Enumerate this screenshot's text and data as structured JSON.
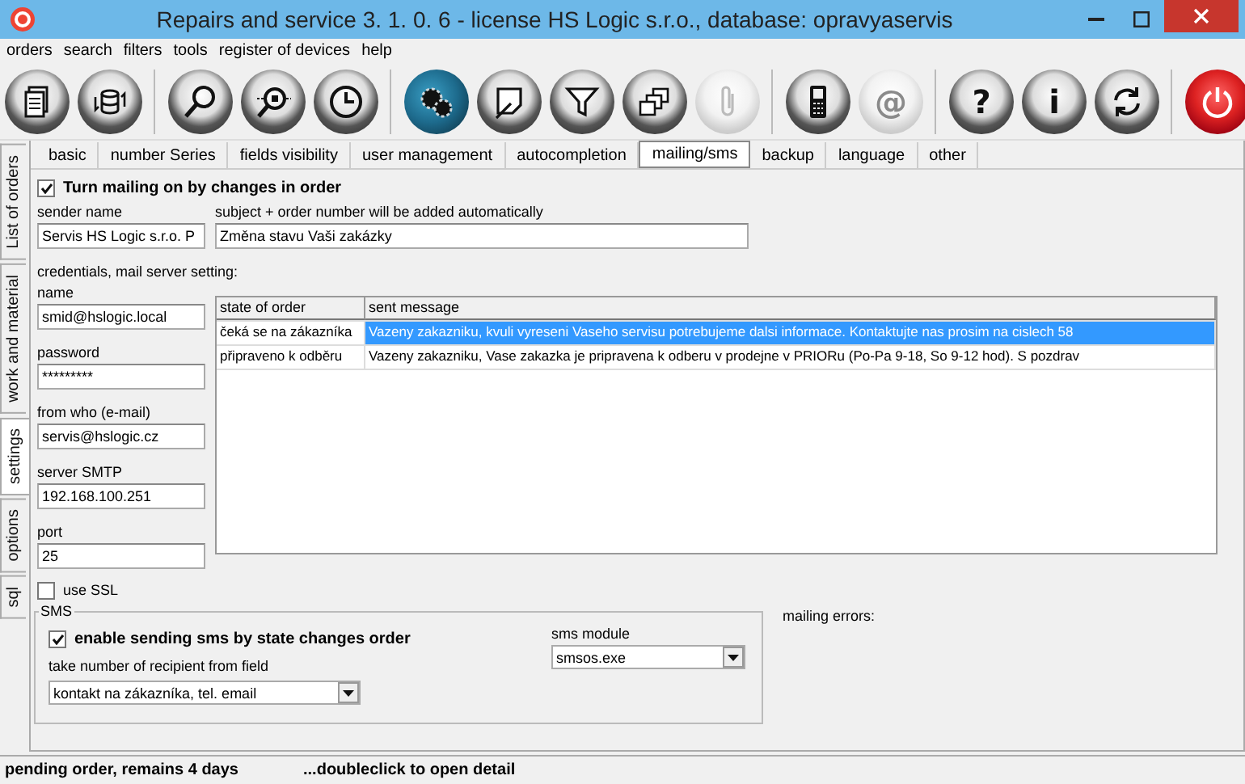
{
  "window": {
    "title": "Repairs and service 3. 1. 0. 6 - license HS Logic s.r.o., database: opravyaservis"
  },
  "menu": [
    "orders",
    "search",
    "filters",
    "tools",
    "register of devices",
    "help"
  ],
  "toolbar_groups": [
    [
      {
        "kind": "documents",
        "disabled": false
      },
      {
        "kind": "database",
        "disabled": false
      }
    ],
    [
      {
        "kind": "search",
        "disabled": false
      },
      {
        "kind": "search-node",
        "disabled": false
      },
      {
        "kind": "clock",
        "disabled": false
      }
    ],
    [
      {
        "kind": "gears",
        "disabled": false
      },
      {
        "kind": "note",
        "disabled": false
      },
      {
        "kind": "filter",
        "disabled": false
      },
      {
        "kind": "windows",
        "disabled": false
      },
      {
        "kind": "paperclip",
        "disabled": true
      }
    ],
    [
      {
        "kind": "phone",
        "disabled": false
      },
      {
        "kind": "glyph",
        "label": "@",
        "disabled": true
      }
    ],
    [
      {
        "kind": "glyph",
        "label": "?",
        "disabled": false
      },
      {
        "kind": "glyph",
        "label": "i",
        "disabled": false
      },
      {
        "kind": "refresh",
        "disabled": false
      }
    ],
    [
      {
        "kind": "power",
        "disabled": false
      }
    ]
  ],
  "side_tabs": [
    {
      "label": "List of orders",
      "selected": false
    },
    {
      "label": "work and material",
      "selected": false
    },
    {
      "label": "settings",
      "selected": true
    },
    {
      "label": "options",
      "selected": false
    },
    {
      "label": "sql",
      "selected": false
    }
  ],
  "tabs": [
    {
      "label": "basic",
      "selected": false
    },
    {
      "label": "number Series",
      "selected": false
    },
    {
      "label": "fields visibility",
      "selected": false
    },
    {
      "label": "user management",
      "selected": false
    },
    {
      "label": "autocompletion",
      "selected": false
    },
    {
      "label": "mailing/sms",
      "selected": true
    },
    {
      "label": "backup",
      "selected": false
    },
    {
      "label": "language",
      "selected": false
    },
    {
      "label": "other",
      "selected": false
    }
  ],
  "mailing": {
    "enable": {
      "label": "Turn mailing on by changes in order",
      "checked": true
    },
    "sender_name": {
      "label": "sender name",
      "value": "Servis HS Logic s.r.o. P"
    },
    "subject": {
      "label": "subject + order number will be added automatically",
      "value": "Změna stavu Vaši zakázky"
    },
    "credentials_heading": "credentials, mail server setting:",
    "fields": [
      {
        "label": "name",
        "value": "smid@hslogic.local"
      },
      {
        "label": "password",
        "value": "*********"
      },
      {
        "label": "from who (e-mail)",
        "value": "servis@hslogic.cz"
      },
      {
        "label": "server SMTP",
        "value": "192.168.100.251"
      },
      {
        "label": "port",
        "value": "25"
      }
    ],
    "use_ssl": {
      "label": "use SSL",
      "checked": false
    },
    "table": {
      "columns": [
        "state of order",
        "sent message"
      ],
      "rows": [
        {
          "state": "čeká se na zákazníka",
          "message": "Vazeny zakazniku, kvuli vyreseni Vaseho servisu potrebujeme dalsi informace. Kontaktujte nas prosim na cislech 58",
          "selected": true
        },
        {
          "state": "připraveno k odběru",
          "message": "Vazeny zakazniku, Vase zakazka je pripravena k odberu v prodejne v PRIORu (Po-Pa 9-18, So 9-12 hod). S pozdrav",
          "selected": false
        }
      ]
    }
  },
  "sms": {
    "title": "SMS",
    "enable": {
      "label": "enable sending sms by state changes order",
      "checked": true
    },
    "recipient": {
      "label": "take number of recipient from field",
      "value": "kontakt na zákazníka, tel. email"
    },
    "module": {
      "label": "sms module",
      "value": "smsos.exe"
    }
  },
  "mailing_errors": "mailing errors:",
  "status_bar": [
    "pending order, remains 4 days",
    "...doubleclick to open detail"
  ]
}
